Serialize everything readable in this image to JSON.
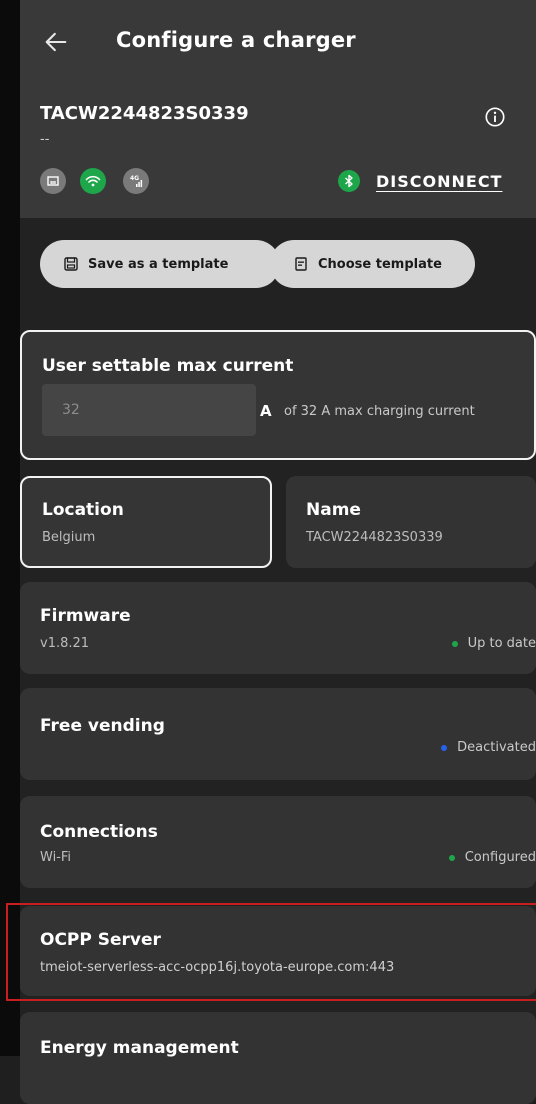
{
  "header": {
    "title": "Configure a charger",
    "serial": "TACW2244823S0339",
    "sub": "--",
    "disconnect_label": "DISCONNECT"
  },
  "icons": {
    "back": "arrow-left-icon",
    "info": "info-icon",
    "ethernet": "ethernet-icon",
    "wifi": "wifi-icon",
    "cellular": "cellular-4g-icon",
    "bluetooth": "bluetooth-icon",
    "save": "save-icon",
    "template": "document-icon"
  },
  "colors": {
    "connected_green": "#1ea64a",
    "inactive_grey": "#7a7a7a",
    "deactivated_blue": "#2563eb",
    "highlight_red": "#c81e1e"
  },
  "templates": {
    "save_label": "Save as a template",
    "choose_label": "Choose template"
  },
  "max_current": {
    "title": "User settable max current",
    "value": "32",
    "unit": "A",
    "description": "of 32 A max charging current"
  },
  "location": {
    "title": "Location",
    "value": "Belgium"
  },
  "name": {
    "title": "Name",
    "value": "TACW2244823S0339"
  },
  "firmware": {
    "title": "Firmware",
    "version": "v1.8.21",
    "status": "Up to date"
  },
  "free_vending": {
    "title": "Free vending",
    "status": "Deactivated"
  },
  "connections": {
    "title": "Connections",
    "value": "Wi-Fi",
    "status": "Configured"
  },
  "ocpp": {
    "title": "OCPP Server",
    "value": "tmeiot-serverless-acc-ocpp16j.toyota-europe.com:443"
  },
  "energy": {
    "title": "Energy management"
  }
}
